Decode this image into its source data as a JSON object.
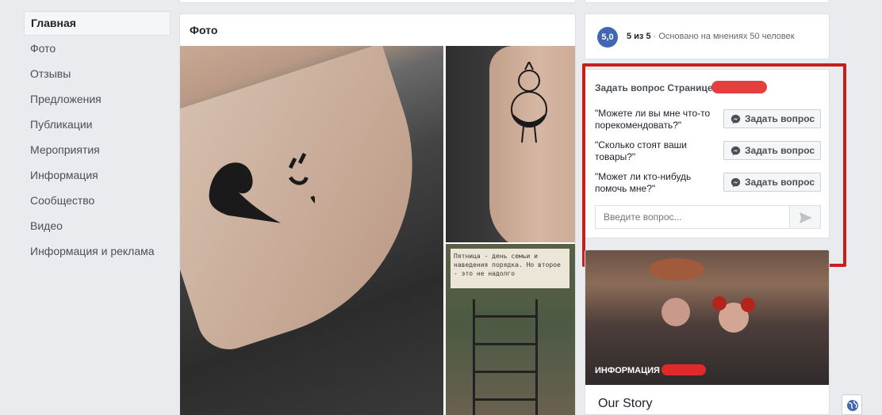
{
  "nav": {
    "items": [
      {
        "label": "Главная",
        "active": true
      },
      {
        "label": "Фото"
      },
      {
        "label": "Отзывы"
      },
      {
        "label": "Предложения"
      },
      {
        "label": "Публикации"
      },
      {
        "label": "Мероприятия"
      },
      {
        "label": "Информация"
      },
      {
        "label": "Сообщество"
      },
      {
        "label": "Видео"
      },
      {
        "label": "Информация и реклама"
      }
    ]
  },
  "photos": {
    "title": "Фото",
    "poster_text": "Пятница - день семьи и наведения порядка. Но второе - это не надолго"
  },
  "rating": {
    "score": "5,0",
    "summary": "5 из 5",
    "separator": " · ",
    "basis": "Основано на мнениях 50 человек"
  },
  "ask": {
    "title": "Задать вопрос Странице",
    "questions": [
      {
        "text": "\"Можете ли вы мне что-то порекомендовать?\"",
        "button": "Задать вопрос"
      },
      {
        "text": "\"Сколько стоят ваши товары?\"",
        "button": "Задать вопрос"
      },
      {
        "text": "\"Может ли кто-нибудь помочь мне?\"",
        "button": "Задать вопрос"
      }
    ],
    "input_placeholder": "Введите вопрос..."
  },
  "info": {
    "label": "ИНФОРМАЦИЯ",
    "story_title": "Our Story"
  },
  "colors": {
    "accent": "#4267b2",
    "highlight": "#c6201c",
    "redaction": "#e02a2a"
  }
}
